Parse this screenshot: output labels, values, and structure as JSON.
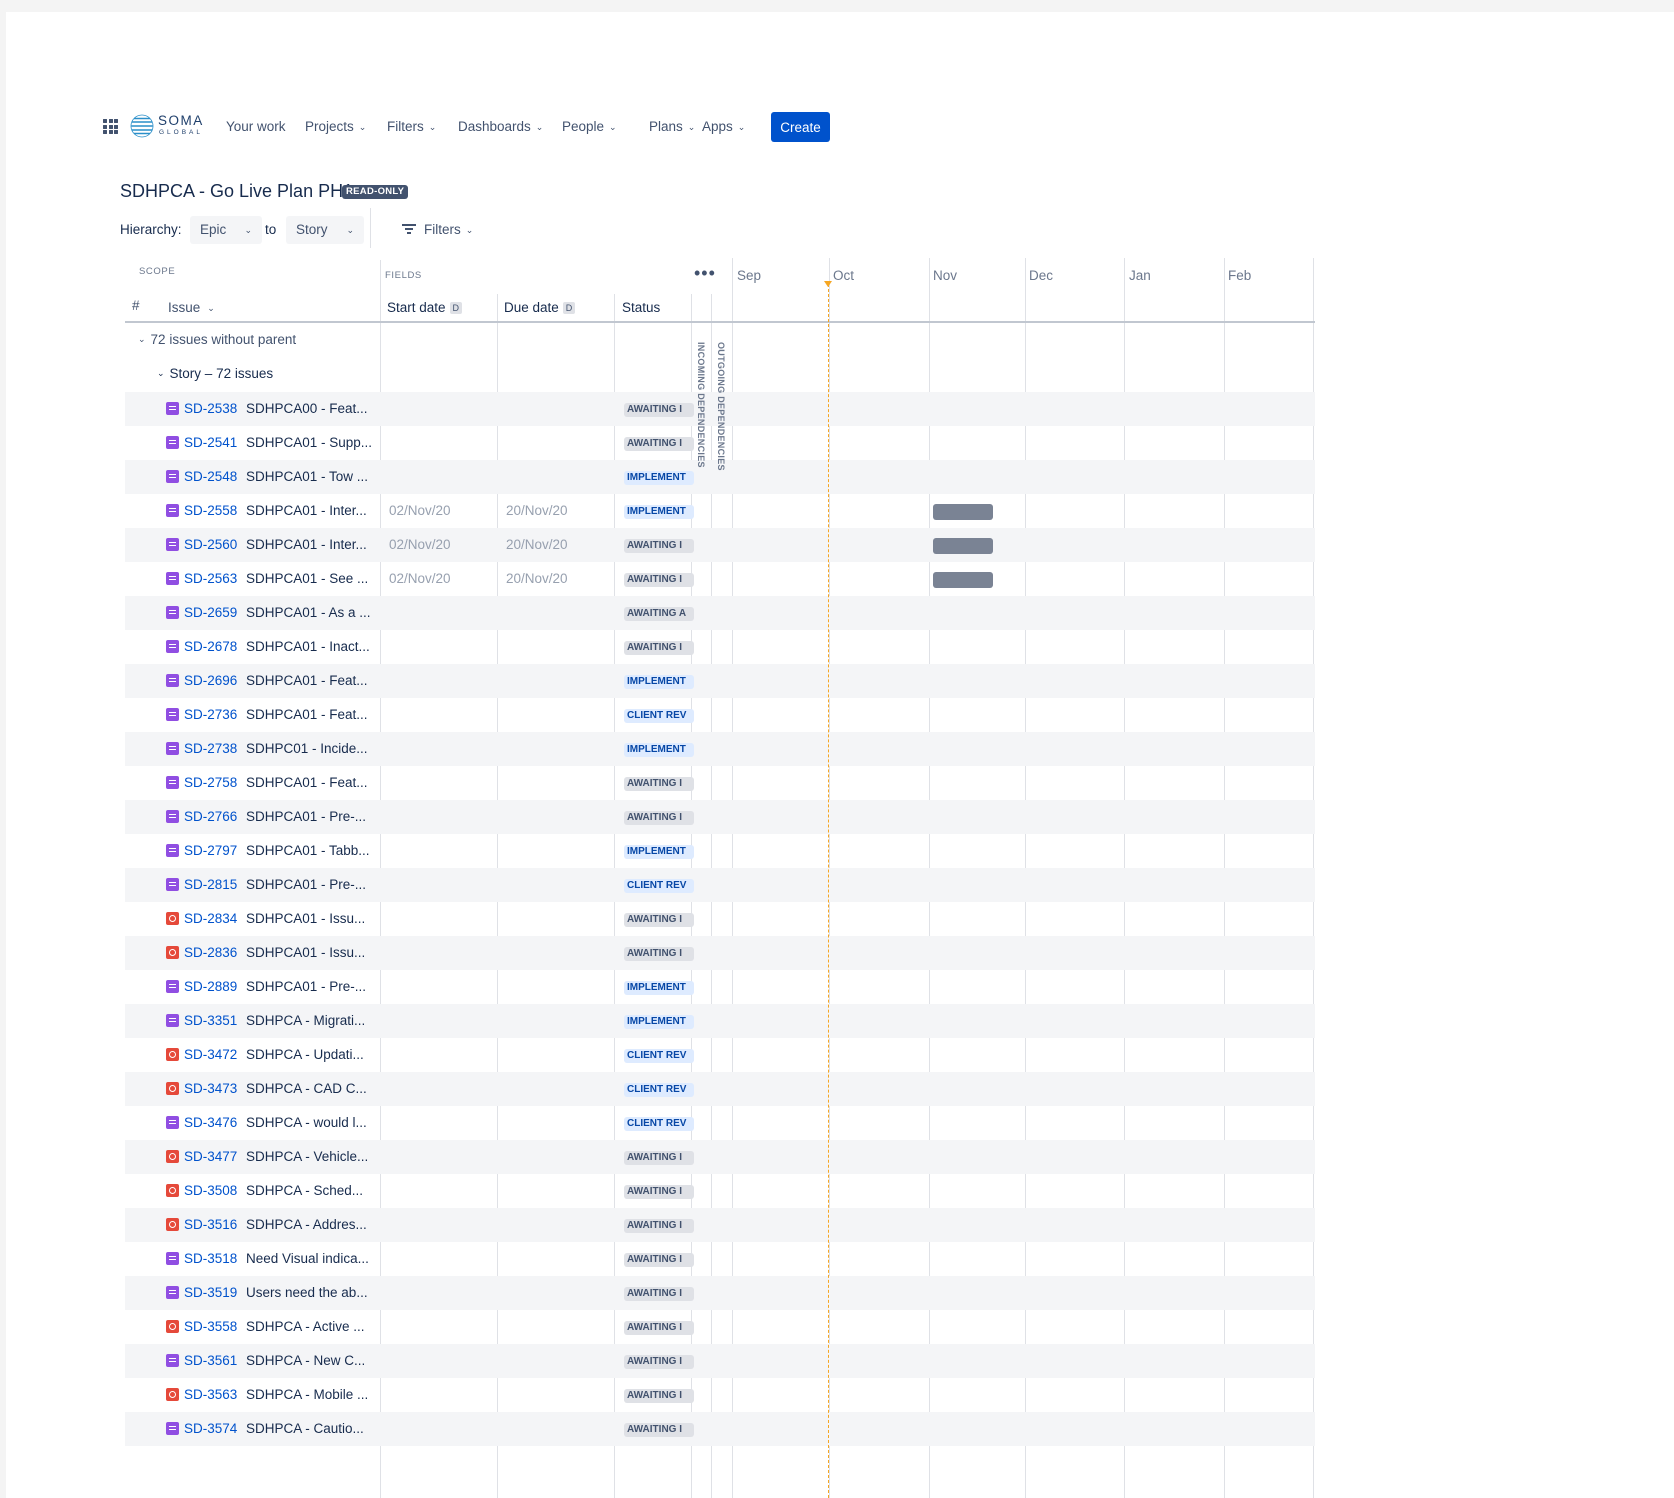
{
  "nav": {
    "logo_text": "SOMA",
    "logo_sub": "GLOBAL",
    "items": [
      {
        "label": "Your work",
        "dropdown": false
      },
      {
        "label": "Projects",
        "dropdown": true
      },
      {
        "label": "Filters",
        "dropdown": true
      },
      {
        "label": "Dashboards",
        "dropdown": true
      },
      {
        "label": "People",
        "dropdown": true
      },
      {
        "label": "Plans",
        "dropdown": true
      },
      {
        "label": "Apps",
        "dropdown": true
      }
    ],
    "create_label": "Create"
  },
  "page": {
    "title": "SDHPCA - Go Live Plan PH1",
    "badge": "READ-ONLY"
  },
  "hierarchy": {
    "label": "Hierarchy:",
    "from": "Epic",
    "to_label": "to",
    "to": "Story",
    "filters_label": "Filters"
  },
  "headers": {
    "scope": "SCOPE",
    "fields": "FIELDS",
    "hash": "#",
    "issue": "Issue",
    "start_date": "Start date",
    "due_date": "Due date",
    "date_badge": "D",
    "status": "Status",
    "incoming": "INCOMING DEPENDENCIES",
    "outgoing": "OUTGOING DEPENDENCIES",
    "months": [
      "Sep",
      "Oct",
      "Nov",
      "Dec",
      "Jan",
      "Feb"
    ]
  },
  "groups": {
    "no_parent": "72 issues without parent",
    "story": "Story – 72 issues"
  },
  "colors": {
    "story": "#904ee2",
    "bug": "#e5493a",
    "link": "#0052cc",
    "bar": "#7a8394",
    "today": "#f5a623"
  },
  "issues": [
    {
      "key": "SD-2538",
      "summary": "SDHPCA00 - Feat...",
      "type": "story",
      "start": "",
      "due": "",
      "status": "AWAITING I",
      "status_color": "grey"
    },
    {
      "key": "SD-2541",
      "summary": "SDHPCA01 - Supp...",
      "type": "story",
      "start": "",
      "due": "",
      "status": "AWAITING I",
      "status_color": "grey"
    },
    {
      "key": "SD-2548",
      "summary": "SDHPCA01 - Tow ...",
      "type": "story",
      "start": "",
      "due": "",
      "status": "IMPLEMENT",
      "status_color": "blue"
    },
    {
      "key": "SD-2558",
      "summary": "SDHPCA01 - Inter...",
      "type": "story",
      "start": "02/Nov/20",
      "due": "20/Nov/20",
      "status": "IMPLEMENT",
      "status_color": "blue",
      "bar": true
    },
    {
      "key": "SD-2560",
      "summary": "SDHPCA01 - Inter...",
      "type": "story",
      "start": "02/Nov/20",
      "due": "20/Nov/20",
      "status": "AWAITING I",
      "status_color": "grey",
      "bar": true
    },
    {
      "key": "SD-2563",
      "summary": "SDHPCA01 - See ...",
      "type": "story",
      "start": "02/Nov/20",
      "due": "20/Nov/20",
      "status": "AWAITING I",
      "status_color": "grey",
      "bar": true
    },
    {
      "key": "SD-2659",
      "summary": "SDHPCA01 - As a ...",
      "type": "story",
      "start": "",
      "due": "",
      "status": "AWAITING A",
      "status_color": "grey"
    },
    {
      "key": "SD-2678",
      "summary": "SDHPCA01 - Inact...",
      "type": "story",
      "start": "",
      "due": "",
      "status": "AWAITING I",
      "status_color": "grey"
    },
    {
      "key": "SD-2696",
      "summary": "SDHPCA01 - Feat...",
      "type": "story",
      "start": "",
      "due": "",
      "status": "IMPLEMENT",
      "status_color": "blue"
    },
    {
      "key": "SD-2736",
      "summary": "SDHPCA01 - Feat...",
      "type": "story",
      "start": "",
      "due": "",
      "status": "CLIENT REV",
      "status_color": "blue"
    },
    {
      "key": "SD-2738",
      "summary": "SDHPC01 - Incide...",
      "type": "story",
      "start": "",
      "due": "",
      "status": "IMPLEMENT",
      "status_color": "blue"
    },
    {
      "key": "SD-2758",
      "summary": "SDHPCA01 - Feat...",
      "type": "story",
      "start": "",
      "due": "",
      "status": "AWAITING I",
      "status_color": "grey"
    },
    {
      "key": "SD-2766",
      "summary": "SDHPCA01 - Pre-...",
      "type": "story",
      "start": "",
      "due": "",
      "status": "AWAITING I",
      "status_color": "grey"
    },
    {
      "key": "SD-2797",
      "summary": "SDHPCA01 - Tabb...",
      "type": "story",
      "start": "",
      "due": "",
      "status": "IMPLEMENT",
      "status_color": "blue"
    },
    {
      "key": "SD-2815",
      "summary": "SDHPCA01 - Pre-...",
      "type": "story",
      "start": "",
      "due": "",
      "status": "CLIENT REV",
      "status_color": "blue"
    },
    {
      "key": "SD-2834",
      "summary": "SDHPCA01 - Issu...",
      "type": "bug",
      "start": "",
      "due": "",
      "status": "AWAITING I",
      "status_color": "grey"
    },
    {
      "key": "SD-2836",
      "summary": "SDHPCA01 - Issu...",
      "type": "bug",
      "start": "",
      "due": "",
      "status": "AWAITING I",
      "status_color": "grey"
    },
    {
      "key": "SD-2889",
      "summary": "SDHPCA01 - Pre-...",
      "type": "story",
      "start": "",
      "due": "",
      "status": "IMPLEMENT",
      "status_color": "blue"
    },
    {
      "key": "SD-3351",
      "summary": "SDHPCA - Migrati...",
      "type": "story",
      "start": "",
      "due": "",
      "status": "IMPLEMENT",
      "status_color": "blue"
    },
    {
      "key": "SD-3472",
      "summary": "SDHPCA - Updati...",
      "type": "bug",
      "start": "",
      "due": "",
      "status": "CLIENT REV",
      "status_color": "blue"
    },
    {
      "key": "SD-3473",
      "summary": "SDHPCA - CAD C...",
      "type": "bug",
      "start": "",
      "due": "",
      "status": "CLIENT REV",
      "status_color": "blue"
    },
    {
      "key": "SD-3476",
      "summary": "SDHPCA - would l...",
      "type": "story",
      "start": "",
      "due": "",
      "status": "CLIENT REV",
      "status_color": "blue"
    },
    {
      "key": "SD-3477",
      "summary": "SDHPCA - Vehicle...",
      "type": "bug",
      "start": "",
      "due": "",
      "status": "AWAITING I",
      "status_color": "grey"
    },
    {
      "key": "SD-3508",
      "summary": "SDHPCA - Sched...",
      "type": "bug",
      "start": "",
      "due": "",
      "status": "AWAITING I",
      "status_color": "grey"
    },
    {
      "key": "SD-3516",
      "summary": "SDHPCA - Addres...",
      "type": "bug",
      "start": "",
      "due": "",
      "status": "AWAITING I",
      "status_color": "grey"
    },
    {
      "key": "SD-3518",
      "summary": "Need Visual indica...",
      "type": "story",
      "start": "",
      "due": "",
      "status": "AWAITING I",
      "status_color": "grey"
    },
    {
      "key": "SD-3519",
      "summary": "Users need the ab...",
      "type": "story",
      "start": "",
      "due": "",
      "status": "AWAITING I",
      "status_color": "grey"
    },
    {
      "key": "SD-3558",
      "summary": "SDHPCA - Active ...",
      "type": "bug",
      "start": "",
      "due": "",
      "status": "AWAITING I",
      "status_color": "grey"
    },
    {
      "key": "SD-3561",
      "summary": "SDHPCA - New C...",
      "type": "story",
      "start": "",
      "due": "",
      "status": "AWAITING I",
      "status_color": "grey"
    },
    {
      "key": "SD-3563",
      "summary": "SDHPCA - Mobile ...",
      "type": "bug",
      "start": "",
      "due": "",
      "status": "AWAITING I",
      "status_color": "grey"
    },
    {
      "key": "SD-3574",
      "summary": "SDHPCA - Cautio...",
      "type": "story",
      "start": "",
      "due": "",
      "status": "AWAITING I",
      "status_color": "grey"
    }
  ]
}
